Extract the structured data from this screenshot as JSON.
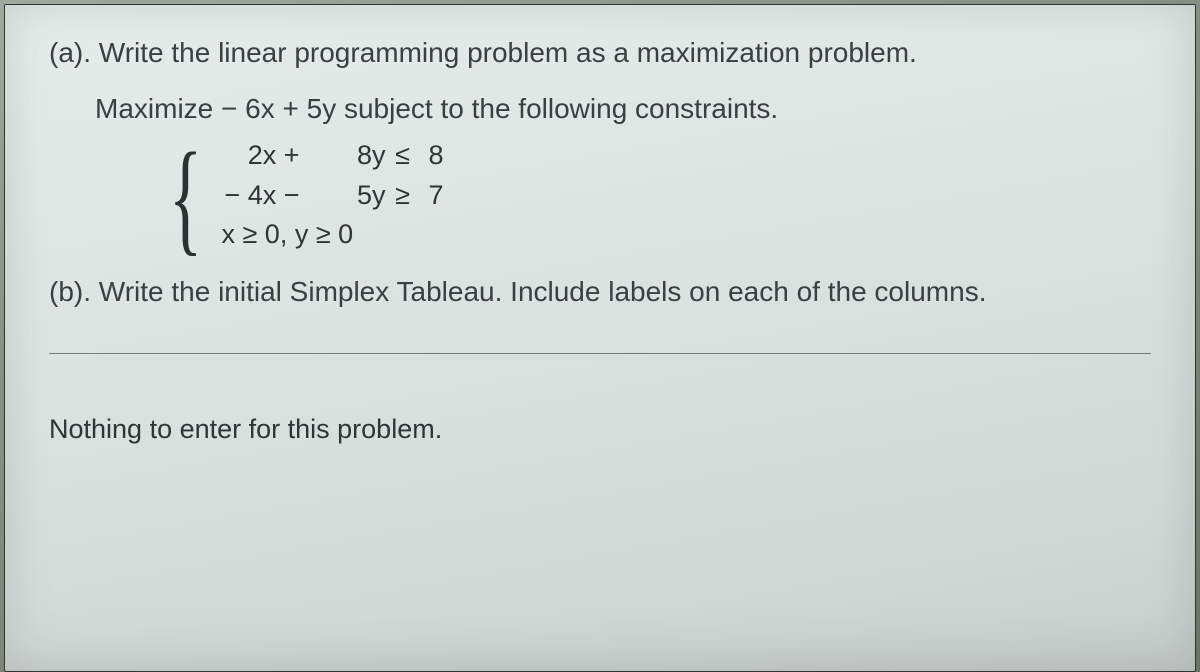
{
  "partA": {
    "label": "(a). Write the linear programming problem as a maximization problem.",
    "objective": "Maximize − 6x + 5y subject to the following constraints.",
    "constraints": {
      "row1": {
        "lhs1": "2x +",
        "lhs2": "8y",
        "op": "≤",
        "rhs": "8"
      },
      "row2": {
        "lhs1": "− 4x −",
        "lhs2": "5y",
        "op": "≥",
        "rhs": "7"
      },
      "nonneg": "x ≥ 0, y ≥ 0"
    }
  },
  "partB": {
    "label": "(b). Write the initial Simplex Tableau.  Include labels on each of the columns."
  },
  "footer": "Nothing to enter for this problem."
}
